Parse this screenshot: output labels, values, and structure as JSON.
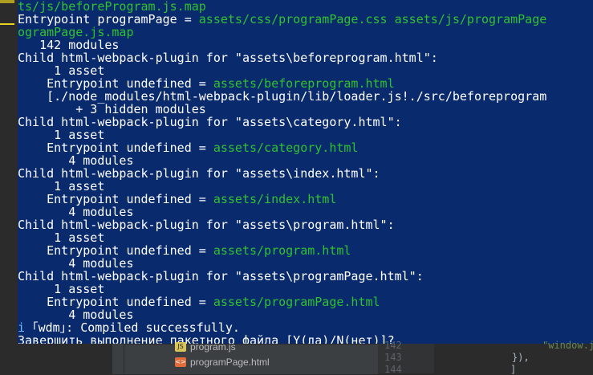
{
  "terminal": {
    "lines": [
      {
        "segs": [
          {
            "t": "ts/js/beforeProgram.js.map",
            "c": "g"
          }
        ]
      },
      {
        "segs": [
          {
            "t": "Entrypoint programPage = ",
            "c": "w"
          },
          {
            "t": "assets/css/programPage.css assets/js/programPage",
            "c": "g"
          }
        ]
      },
      {
        "segs": [
          {
            "t": "ogramPage.js.map",
            "c": "g"
          }
        ]
      },
      {
        "segs": [
          {
            "t": "   142 modules",
            "c": "w"
          }
        ]
      },
      {
        "segs": [
          {
            "t": "Child html-webpack-plugin for \"assets\\beforeprogram.html\":",
            "c": "w"
          }
        ]
      },
      {
        "segs": [
          {
            "t": "     1 asset",
            "c": "w"
          }
        ]
      },
      {
        "segs": [
          {
            "t": "    Entrypoint undefined = ",
            "c": "w"
          },
          {
            "t": "assets/beforeprogram.html",
            "c": "g"
          }
        ]
      },
      {
        "segs": [
          {
            "t": "    [./node_modules/html-webpack-plugin/lib/loader.js!./src/beforeprogram",
            "c": "w"
          }
        ]
      },
      {
        "segs": [
          {
            "t": "        + 3 hidden modules",
            "c": "w"
          }
        ]
      },
      {
        "segs": [
          {
            "t": "Child html-webpack-plugin for \"assets\\category.html\":",
            "c": "w"
          }
        ]
      },
      {
        "segs": [
          {
            "t": "     1 asset",
            "c": "w"
          }
        ]
      },
      {
        "segs": [
          {
            "t": "    Entrypoint undefined = ",
            "c": "w"
          },
          {
            "t": "assets/category.html",
            "c": "g"
          }
        ]
      },
      {
        "segs": [
          {
            "t": "       4 modules",
            "c": "w"
          }
        ]
      },
      {
        "segs": [
          {
            "t": "Child html-webpack-plugin for \"assets\\index.html\":",
            "c": "w"
          }
        ]
      },
      {
        "segs": [
          {
            "t": "     1 asset",
            "c": "w"
          }
        ]
      },
      {
        "segs": [
          {
            "t": "    Entrypoint undefined = ",
            "c": "w"
          },
          {
            "t": "assets/index.html",
            "c": "g"
          }
        ]
      },
      {
        "segs": [
          {
            "t": "       4 modules",
            "c": "w"
          }
        ]
      },
      {
        "segs": [
          {
            "t": "Child html-webpack-plugin for \"assets\\program.html\":",
            "c": "w"
          }
        ]
      },
      {
        "segs": [
          {
            "t": "     1 asset",
            "c": "w"
          }
        ]
      },
      {
        "segs": [
          {
            "t": "    Entrypoint undefined = ",
            "c": "w"
          },
          {
            "t": "assets/program.html",
            "c": "g"
          }
        ]
      },
      {
        "segs": [
          {
            "t": "       4 modules",
            "c": "w"
          }
        ]
      },
      {
        "segs": [
          {
            "t": "Child html-webpack-plugin for \"assets\\programPage.html\":",
            "c": "w"
          }
        ]
      },
      {
        "segs": [
          {
            "t": "     1 asset",
            "c": "w"
          }
        ]
      },
      {
        "segs": [
          {
            "t": "    Entrypoint undefined = ",
            "c": "w"
          },
          {
            "t": "assets/programPage.html",
            "c": "g"
          }
        ]
      },
      {
        "segs": [
          {
            "t": "       4 modules",
            "c": "w"
          }
        ]
      },
      {
        "segs": [
          {
            "t": "i ",
            "c": "b"
          },
          {
            "t": "｢wdm｣: Compiled successfully.",
            "c": "w"
          }
        ]
      },
      {
        "segs": [
          {
            "t": "Завершить выполнение пакетного файла [Y(да)/N(нет)]?",
            "c": "w"
          }
        ]
      }
    ]
  },
  "project_tree": {
    "files": [
      {
        "name": "program.js",
        "icon": "js-file-icon"
      },
      {
        "name": "programPage.html",
        "icon": "html-file-icon"
      }
    ]
  },
  "editor": {
    "line_numbers": [
      "142",
      "143",
      "144"
    ],
    "code_lines": [
      "\"window.j",
      "}),",
      "]"
    ]
  },
  "colors": {
    "terminal_bg": "#0a2a6e",
    "terminal_text": "#ffffff",
    "terminal_green": "#2ec22e",
    "ide_bg": "#2b2b2b",
    "accent_yellow": "#e7d21f"
  }
}
